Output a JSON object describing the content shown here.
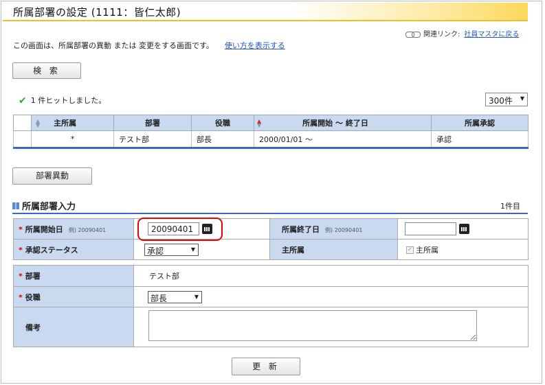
{
  "title": "所属部署の設定 (1111：皆仁太郎)",
  "related": {
    "label": "関連リンク:",
    "link": "社員マスタに戻る"
  },
  "description": {
    "text": "この画面は、所属部署の異動 または 変更をする画面です。",
    "help_link": "使い方を表示する"
  },
  "search_button": "検 索",
  "result": {
    "hit_text": "1 件ヒットしました。",
    "per_page": "300件"
  },
  "table": {
    "headers": [
      "主所属",
      "部署",
      "役職",
      "所属開始 〜 終了日",
      "所属承認"
    ],
    "rows": [
      {
        "main": "*",
        "dept": "テスト部",
        "post": "部長",
        "period": "2000/01/01 〜",
        "approval": "承認"
      }
    ]
  },
  "transfer_button": "部署異動",
  "section": {
    "title": "所属部署入力",
    "count": "1件目"
  },
  "form": {
    "start_label": "所属開始日",
    "start_example": "例) 20090401",
    "start_value": "20090401",
    "end_label": "所属終了日",
    "end_example": "例) 20090401",
    "end_value": "",
    "status_label": "承認ステータス",
    "status_value": "承認",
    "main_label": "主所属",
    "main_checkbox": "主所属",
    "dept_label": "部署",
    "dept_value": "テスト部",
    "post_label": "役職",
    "post_value": "部長",
    "note_label": "備考",
    "note_value": "",
    "required_mark": "*"
  },
  "update_button": "更 新"
}
